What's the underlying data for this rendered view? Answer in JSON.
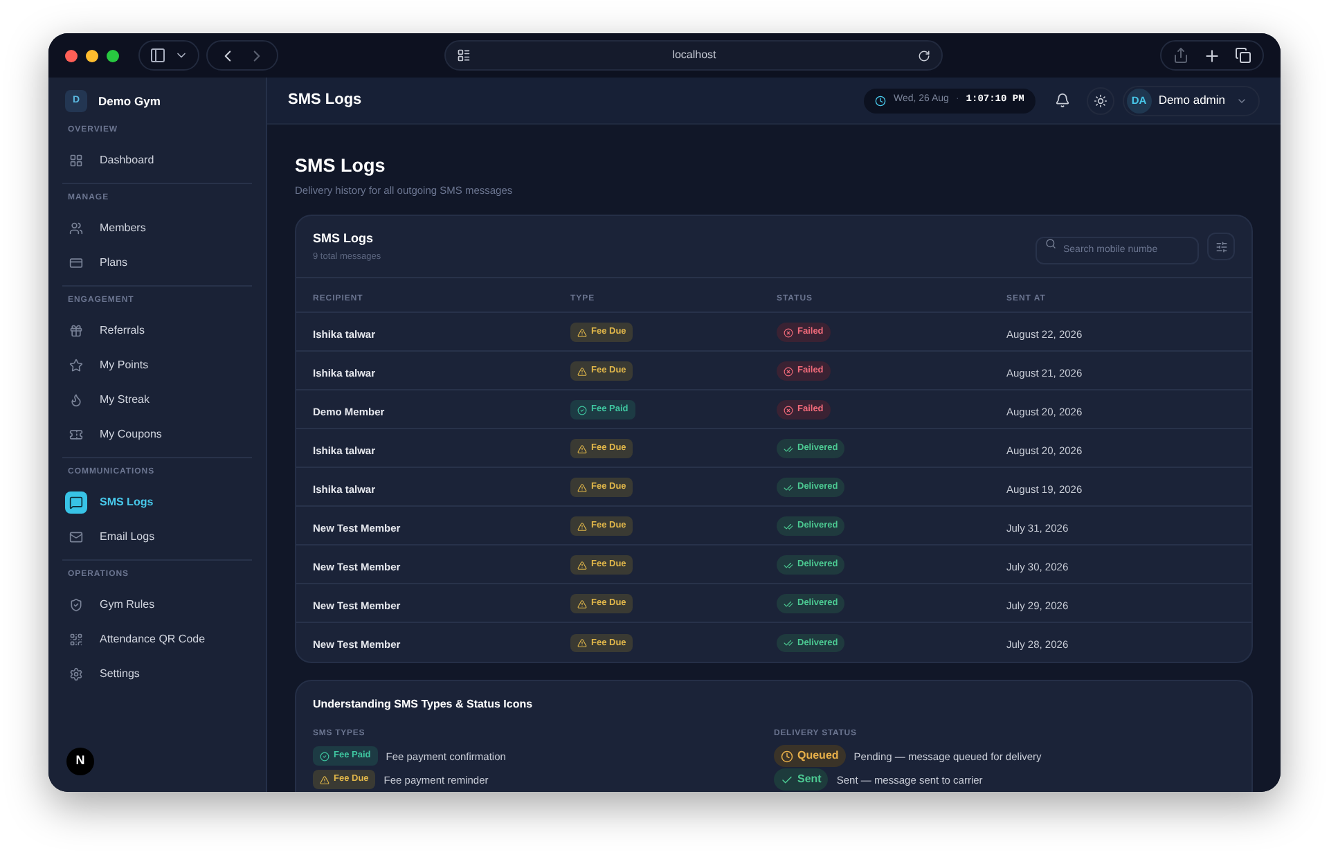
{
  "browser": {
    "url": "localhost"
  },
  "sidebar": {
    "brand_initial": "D",
    "brand": "Demo Gym",
    "sections": [
      {
        "title": "OVERVIEW",
        "items": [
          {
            "label": "Dashboard",
            "selected": false
          }
        ]
      },
      {
        "title": "MANAGE",
        "items": [
          {
            "label": "Members",
            "selected": false
          },
          {
            "label": "Plans",
            "selected": false
          }
        ]
      },
      {
        "title": "ENGAGEMENT",
        "items": [
          {
            "label": "Referrals",
            "selected": false
          },
          {
            "label": "My Points",
            "selected": false
          },
          {
            "label": "My Streak",
            "selected": false
          },
          {
            "label": "My Coupons",
            "selected": false
          }
        ]
      },
      {
        "title": "COMMUNICATIONS",
        "items": [
          {
            "label": "SMS Logs",
            "selected": true
          },
          {
            "label": "Email Logs",
            "selected": false
          }
        ]
      },
      {
        "title": "OPERATIONS",
        "items": [
          {
            "label": "Gym Rules",
            "selected": false
          },
          {
            "label": "Attendance QR Code",
            "selected": false
          },
          {
            "label": "Settings",
            "selected": false
          }
        ]
      }
    ],
    "footer_badge": "N"
  },
  "header": {
    "title": "SMS Logs",
    "date": "Wed, 26 Aug",
    "separator": "·",
    "time": "1:07:10 PM",
    "user_initials": "DA",
    "user_name": "Demo admin"
  },
  "page": {
    "title": "SMS Logs",
    "subtitle": "Delivery history for all outgoing SMS messages"
  },
  "logs_card": {
    "title": "SMS Logs",
    "count": "9 total messages",
    "search": {
      "placeholder": "Search mobile numbe"
    },
    "columns": [
      "RECIPIENT",
      "TYPE",
      "STATUS",
      "SENT AT"
    ],
    "rows": [
      {
        "recipient": "Ishika talwar",
        "type": {
          "kind": "due",
          "label": "Fee Due"
        },
        "status": {
          "kind": "failed",
          "label": "Failed"
        },
        "sent_at": "August 22, 2026"
      },
      {
        "recipient": "Ishika talwar",
        "type": {
          "kind": "due",
          "label": "Fee Due"
        },
        "status": {
          "kind": "failed",
          "label": "Failed"
        },
        "sent_at": "August 21, 2026"
      },
      {
        "recipient": "Demo Member",
        "type": {
          "kind": "paid",
          "label": "Fee Paid"
        },
        "status": {
          "kind": "failed",
          "label": "Failed"
        },
        "sent_at": "August 20, 2026"
      },
      {
        "recipient": "Ishika talwar",
        "type": {
          "kind": "due",
          "label": "Fee Due"
        },
        "status": {
          "kind": "delivered",
          "label": "Delivered"
        },
        "sent_at": "August 20, 2026"
      },
      {
        "recipient": "Ishika talwar",
        "type": {
          "kind": "due",
          "label": "Fee Due"
        },
        "status": {
          "kind": "delivered",
          "label": "Delivered"
        },
        "sent_at": "August 19, 2026"
      },
      {
        "recipient": "New Test Member",
        "type": {
          "kind": "due",
          "label": "Fee Due"
        },
        "status": {
          "kind": "delivered",
          "label": "Delivered"
        },
        "sent_at": "July 31, 2026"
      },
      {
        "recipient": "New Test Member",
        "type": {
          "kind": "due",
          "label": "Fee Due"
        },
        "status": {
          "kind": "delivered",
          "label": "Delivered"
        },
        "sent_at": "July 30, 2026"
      },
      {
        "recipient": "New Test Member",
        "type": {
          "kind": "due",
          "label": "Fee Due"
        },
        "status": {
          "kind": "delivered",
          "label": "Delivered"
        },
        "sent_at": "July 29, 2026"
      },
      {
        "recipient": "New Test Member",
        "type": {
          "kind": "due",
          "label": "Fee Due"
        },
        "status": {
          "kind": "delivered",
          "label": "Delivered"
        },
        "sent_at": "July 28, 2026"
      }
    ]
  },
  "legend_card": {
    "title": "Understanding SMS Types & Status Icons",
    "types_title": "SMS TYPES",
    "types": [
      {
        "kind": "paid",
        "label": "Fee Paid",
        "description": "Fee payment confirmation"
      },
      {
        "kind": "due",
        "label": "Fee Due",
        "description": "Fee payment reminder"
      }
    ],
    "status_title": "DELIVERY STATUS",
    "statuses": [
      {
        "kind": "queued",
        "label": "Queued",
        "description": "Pending — message queued for delivery"
      },
      {
        "kind": "sent",
        "label": "Sent",
        "description": "Sent — message sent to carrier"
      }
    ]
  }
}
